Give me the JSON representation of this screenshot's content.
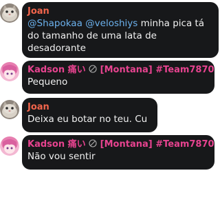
{
  "messages": [
    {
      "author": "Joan",
      "mentions": [
        "@Shapokaa",
        "@veloshiys"
      ],
      "text_line1_rest": " minha pica tá",
      "text_line2": "do tamanho de uma lata de",
      "text_line3": "desadorante",
      "name_color": "#f2654c"
    },
    {
      "author_prefix": "Kadson 痛い",
      "author_suffix": " [Montana] #Team7870",
      "text": "Pequeno",
      "name_color": "#e6438f"
    },
    {
      "author": "Joan",
      "text": "Deixa eu botar no teu. Cu",
      "name_color": "#f2654c"
    },
    {
      "author_prefix": "Kadson 痛い",
      "author_suffix": " [Montana] #Team7870",
      "text": "Não vou sentir",
      "name_color": "#e6438f"
    }
  ],
  "colors": {
    "bubble": "#17181a",
    "mention": "#6cb2ee",
    "text": "#f1f1f1"
  },
  "icons": [
    "cat-avatar-icon",
    "anime-girl-avatar-icon",
    "prohibited-circle-icon"
  ]
}
